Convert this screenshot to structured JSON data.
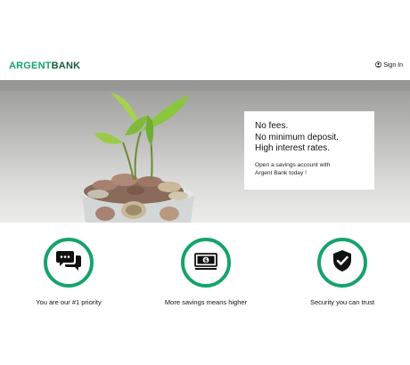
{
  "header": {
    "brand_part1": "ARGENT",
    "brand_part2": "BANK",
    "signin_label": "Sign In",
    "signin_icon": "user-circle-icon"
  },
  "hero": {
    "image": "coins-jar-with-seedling",
    "promo_lines": [
      "No fees.",
      "No minimum deposit.",
      "High interest rates."
    ],
    "promo_sub_lines": [
      "Open a savings account with",
      "Argent Bank today !"
    ]
  },
  "features": [
    {
      "icon": "chat-bubbles-icon",
      "caption": "You are our #1 priority"
    },
    {
      "icon": "money-bill-icon",
      "caption": "More savings means higher"
    },
    {
      "icon": "shield-check-icon",
      "caption": "Security you can trust"
    }
  ],
  "colors": {
    "brand_green": "#16a36a",
    "brand_dark_green": "#1c5a3e",
    "text": "#111111",
    "background": "#ffffff"
  }
}
